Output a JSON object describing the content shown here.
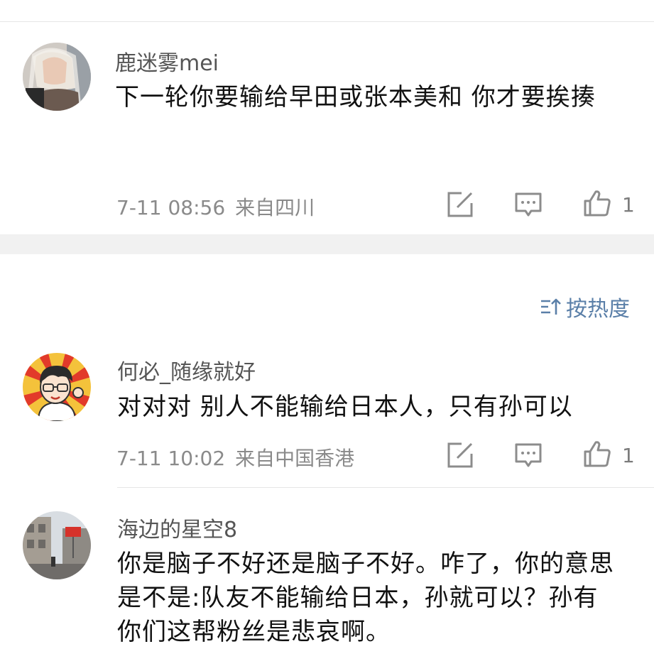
{
  "comment1": {
    "username": "鹿迷雾mei",
    "text": "下一轮你要输给早田或张本美和 你才要挨揍",
    "time": "7-11 08:56",
    "location": "来自四川",
    "like_count": "1"
  },
  "sort": {
    "label": "按热度"
  },
  "comment2": {
    "username": "何必_随缘就好",
    "text": "对对对 别人不能输给日本人，只有孙可以",
    "time": "7-11 10:02",
    "location": "来自中国香港",
    "like_count": "1"
  },
  "comment3": {
    "username": "海边的星空8",
    "text": "你是脑子不好还是脑子不好。咋了，你的意思是不是:队友不能输给日本，孙就可以？孙有你们这帮粉丝是悲哀啊。"
  },
  "icons": {
    "share": "share-icon",
    "reply": "comment-icon",
    "like": "thumb-up-icon",
    "sort": "sort-icon"
  },
  "colors": {
    "username": "#555555",
    "meta": "#8a8a8a",
    "sort_accent": "#5a7fa8",
    "divider": "#f1f1f1"
  }
}
